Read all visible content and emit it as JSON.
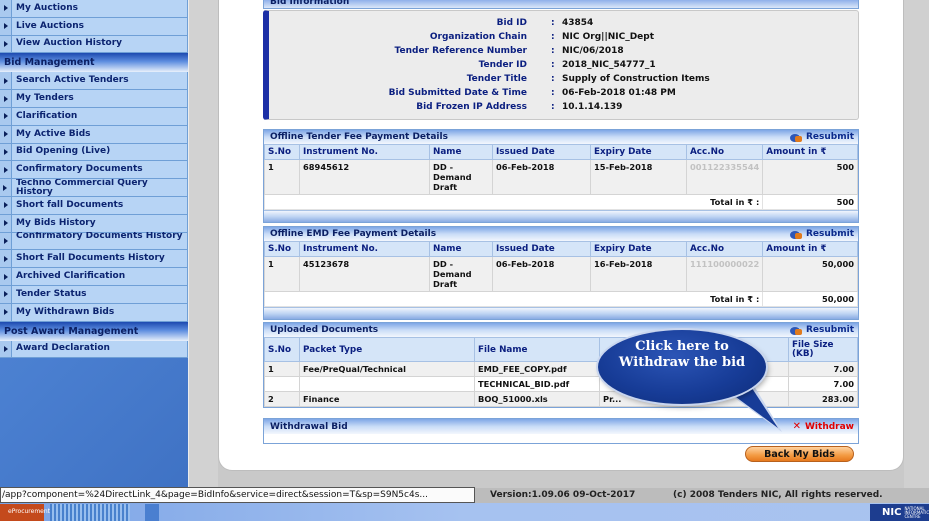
{
  "sidebar": {
    "items_top": [
      {
        "label": "My Auctions"
      },
      {
        "label": "Live Auctions"
      },
      {
        "label": "View Auction History"
      }
    ],
    "section_bid": "Bid Management",
    "items_bid": [
      {
        "label": "Search Active Tenders"
      },
      {
        "label": "My Tenders"
      },
      {
        "label": "Clarification"
      },
      {
        "label": "My Active Bids"
      },
      {
        "label": "Bid Opening (Live)"
      },
      {
        "label": "Confirmatory Documents"
      },
      {
        "label": "Techno Commercial Query History"
      },
      {
        "label": "Short fall Documents"
      },
      {
        "label": "My Bids History"
      },
      {
        "label": "Confirmatory Documents History"
      },
      {
        "label": "Short Fall Documents History"
      },
      {
        "label": "Archived Clarification"
      },
      {
        "label": "Tender Status"
      },
      {
        "label": "My Withdrawn Bids"
      }
    ],
    "section_post": "Post Award Management",
    "items_post": [
      {
        "label": "Award Declaration"
      }
    ]
  },
  "bid_info": {
    "title": "Bid Information",
    "fields": [
      {
        "key": "Bid ID",
        "value": "43854"
      },
      {
        "key": "Organization Chain",
        "value": "NIC Org||NIC_Dept"
      },
      {
        "key": "Tender Reference Number",
        "value": "NIC/06/2018"
      },
      {
        "key": "Tender ID",
        "value": "2018_NIC_54777_1"
      },
      {
        "key": "Tender Title",
        "value": "Supply of Construction Items"
      },
      {
        "key": "Bid Submitted Date & Time",
        "value": "06-Feb-2018 01:48 PM"
      },
      {
        "key": "Bid Frozen IP Address",
        "value": "10.1.14.139"
      }
    ],
    "separator": ":"
  },
  "resubmit_label": "Resubmit",
  "tender_fee": {
    "title": "Offline Tender Fee Payment Details",
    "columns": [
      "S.No",
      "Instrument No.",
      "Name",
      "Issued Date",
      "Expiry Date",
      "Acc.No",
      "Amount in ₹"
    ],
    "rows": [
      {
        "sno": "1",
        "instrument": "68945612",
        "name": "DD - Demand Draft",
        "issued": "06-Feb-2018",
        "expiry": "15-Feb-2018",
        "acc": "001122335544",
        "amount": "500"
      }
    ],
    "total_label": "Total in ₹ :",
    "total": "500"
  },
  "emd_fee": {
    "title": "Offline EMD Fee Payment Details",
    "columns": [
      "S.No",
      "Instrument No.",
      "Name",
      "Issued Date",
      "Expiry Date",
      "Acc.No",
      "Amount in ₹"
    ],
    "rows": [
      {
        "sno": "1",
        "instrument": "45123678",
        "name": "DD - Demand Draft",
        "issued": "06-Feb-2018",
        "expiry": "16-Feb-2018",
        "acc": "111100000022",
        "amount": "50,000"
      }
    ],
    "total_label": "Total in ₹ :",
    "total": "50,000"
  },
  "uploaded_docs": {
    "title": "Uploaded Documents",
    "columns": [
      "S.No",
      "Packet Type",
      "File Name",
      "",
      "File Size (KB)"
    ],
    "rows": [
      {
        "sno": "1",
        "packet": "Fee/PreQual/Technical",
        "file": "EMD_FEE_COPY.pdf",
        "desc": "",
        "size": "7.00"
      },
      {
        "sno": "",
        "packet": "",
        "file": "TECHNICAL_BID.pdf",
        "desc": "",
        "size": "7.00"
      },
      {
        "sno": "2",
        "packet": "Finance",
        "file": "BOQ_51000.xls",
        "desc": "Pr...",
        "size": "283.00"
      }
    ]
  },
  "withdrawal": {
    "title": "Withdrawal Bid",
    "action_label": "Withdraw",
    "action_icon": "✕"
  },
  "back_button": "Back My Bids",
  "callout": "Click here to Withdraw the bid",
  "status_url": "/app?component=%24DirectLink_4&page=BidInfo&service=direct&session=T&sp=S9N5c4s...",
  "footer": {
    "version": "Version:1.09.06 09-Oct-2017",
    "copyright": "(c) 2008 Tenders NIC, All rights reserved."
  },
  "taskbar": {
    "eprocurement": "eProcurement",
    "nic": "NIC",
    "nic_sub": "NATIONAL INFORMATICS CENTRE"
  }
}
